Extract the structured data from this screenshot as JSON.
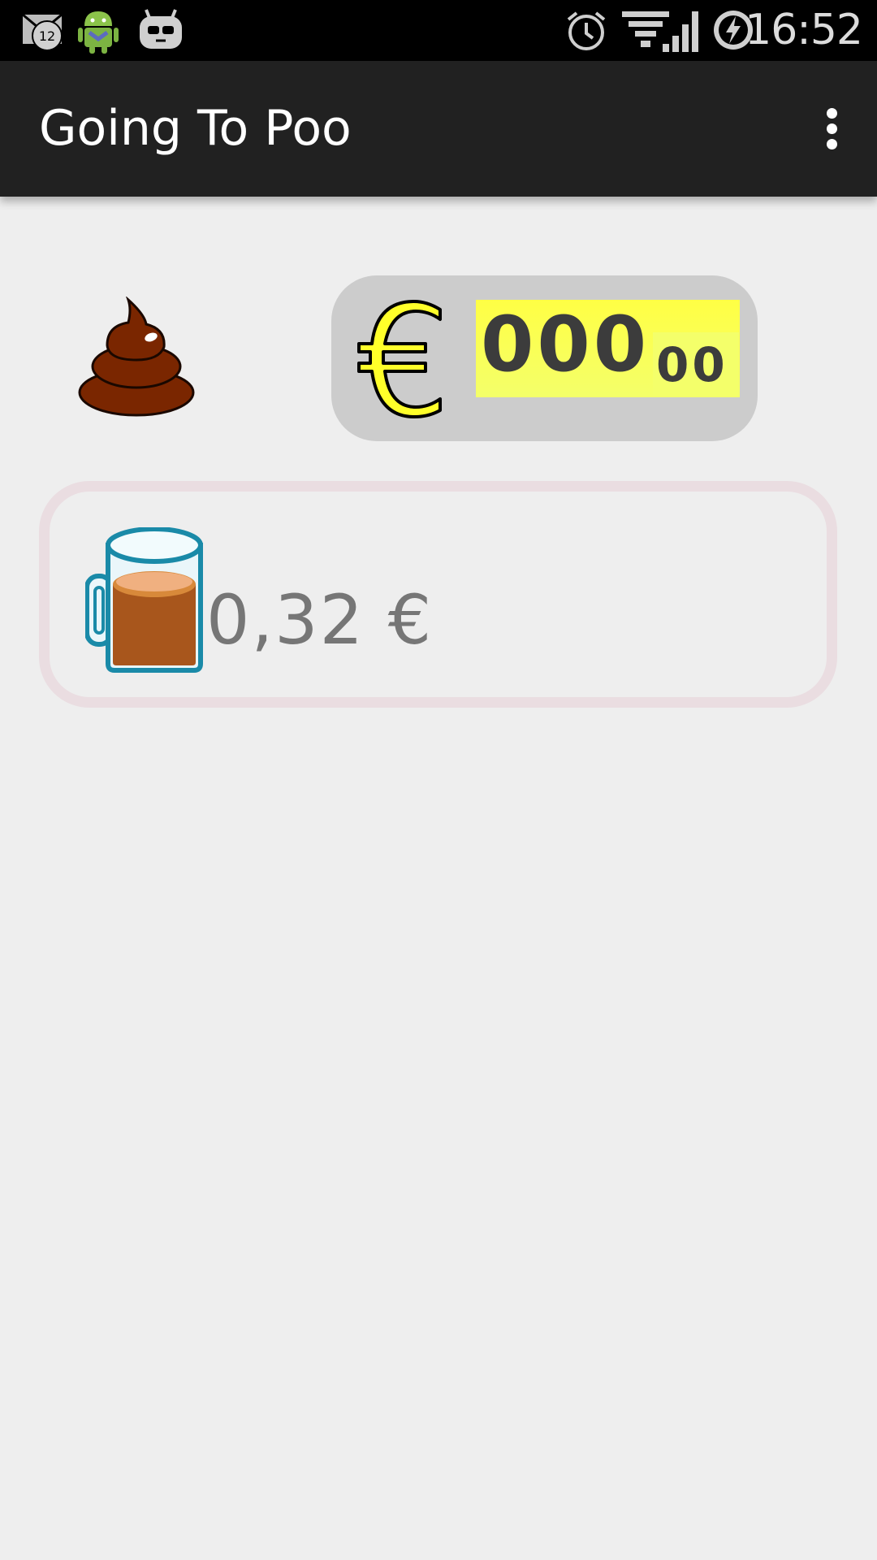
{
  "status_bar": {
    "time": "16:52",
    "notification_count": "12",
    "icons": [
      "mail-notification-icon",
      "android-debug-icon",
      "cyanogen-mascot-icon",
      "alarm-icon",
      "wifi-icon",
      "cell-signal-icon",
      "battery-charging-icon"
    ]
  },
  "action_bar": {
    "title": "Going To Poo",
    "overflow_icon": "more-vert-icon"
  },
  "counter": {
    "currency_icon": "euro-icon",
    "main_digits": "000",
    "cents_digits": "00"
  },
  "coffee": {
    "icon": "coffee-mug-icon",
    "price": "0,32 €"
  },
  "colors": {
    "status_bar": "#000000",
    "action_bar": "#212121",
    "background": "#eeeeee",
    "counter_panel": "#cccccc",
    "digit_highlight": "#ffff44",
    "card_border": "#eadde1",
    "price_text": "#767676"
  }
}
